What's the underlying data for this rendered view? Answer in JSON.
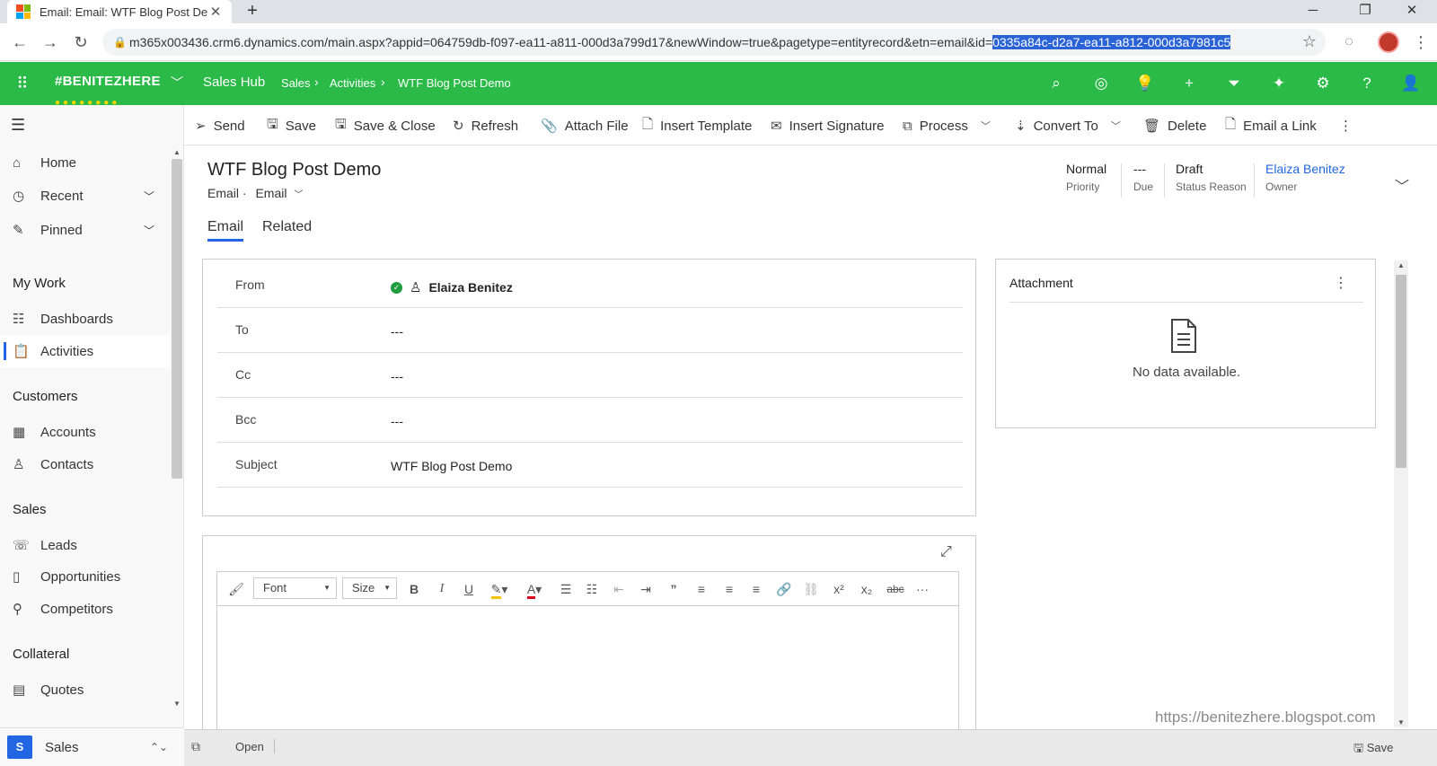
{
  "browser": {
    "tab_title": "Email: Email: WTF Blog Post Dem",
    "url_prefix": "m365x003436.crm6.dynamics.com/main.aspx?appid=064759db-f097-ea11-a811-000d3a799d17&newWindow=true&pagetype=entityrecord&etn=email&id=",
    "url_selected": "0335a84c-d2a7-ea11-a812-000d3a7981c5",
    "new_tab": "+",
    "minimize": "─",
    "maximize": "❐",
    "close": "✕"
  },
  "header": {
    "org": "#BENITEZHERE",
    "org_dots": "●●●●●●●●",
    "app": "Sales Hub",
    "breadcrumbs": [
      "Sales",
      "Activities",
      "WTF Blog Post Demo"
    ],
    "brand_color": "#2bba48"
  },
  "sidebar": {
    "items": [
      {
        "label": "Home",
        "icon": "home-icon"
      },
      {
        "label": "Recent",
        "icon": "clock-icon"
      },
      {
        "label": "Pinned",
        "icon": "pin-icon"
      }
    ],
    "groups": [
      {
        "title": "My Work",
        "items": [
          {
            "label": "Dashboards"
          },
          {
            "label": "Activities"
          }
        ]
      },
      {
        "title": "Customers",
        "items": [
          {
            "label": "Accounts"
          },
          {
            "label": "Contacts"
          }
        ]
      },
      {
        "title": "Sales",
        "items": [
          {
            "label": "Leads"
          },
          {
            "label": "Opportunities"
          },
          {
            "label": "Competitors"
          }
        ]
      },
      {
        "title": "Collateral",
        "items": [
          {
            "label": "Quotes"
          }
        ]
      }
    ],
    "area": {
      "badge": "S",
      "label": "Sales"
    }
  },
  "commands": {
    "send": "Send",
    "save": "Save",
    "save_close": "Save & Close",
    "refresh": "Refresh",
    "attach": "Attach File",
    "insert_template": "Insert Template",
    "insert_signature": "Insert Signature",
    "process": "Process",
    "convert_to": "Convert To",
    "delete": "Delete",
    "email_link": "Email a Link"
  },
  "record": {
    "title": "WTF Blog Post Demo",
    "entity": "Email",
    "form": "Email",
    "header_fields": {
      "priority_value": "Normal",
      "priority_label": "Priority",
      "due_value": "---",
      "due_label": "Due",
      "status_value": "Draft",
      "status_label": "Status Reason",
      "owner_value": "Elaiza Benitez",
      "owner_label": "Owner"
    },
    "tabs": [
      "Email",
      "Related"
    ]
  },
  "form": {
    "from_label": "From",
    "from_value": "Elaiza Benitez",
    "to_label": "To",
    "to_value": "---",
    "cc_label": "Cc",
    "cc_value": "---",
    "bcc_label": "Bcc",
    "bcc_value": "---",
    "subject_label": "Subject",
    "subject_value": "WTF Blog Post Demo"
  },
  "attachment": {
    "title": "Attachment",
    "empty": "No data available."
  },
  "editor": {
    "font": "Font",
    "size": "Size"
  },
  "footer": {
    "status": "Open",
    "save": "Save"
  },
  "watermark": "https://benitezhere.blogspot.com"
}
